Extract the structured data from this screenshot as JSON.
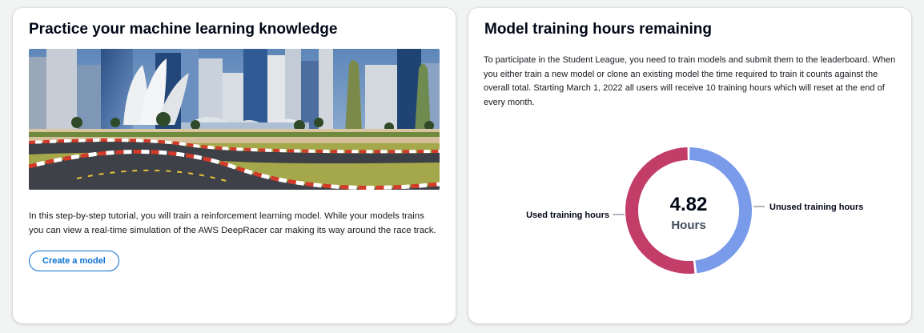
{
  "practice": {
    "title": "Practice your machine learning knowledge",
    "image_alt": "AWS DeepRacer race track in a city",
    "description": "In this step-by-step tutorial, you will train a reinforcement learning model. While your models trains you can view a real-time simulation of the AWS DeepRacer car making its way around the race track.",
    "button_label": "Create a model"
  },
  "training_hours": {
    "title": "Model training hours remaining",
    "description": "To participate in the Student League, you need to train models and submit them to the leaderboard. When you either train a new model or clone an existing model the time required to train it counts against the overall total. Starting March 1, 2022 all users will receive 10 training hours which will reset at the end of every month.",
    "value": "4.82",
    "unit": "Hours",
    "used_label": "Used training hours",
    "unused_label": "Unused training hours",
    "chart_data": {
      "type": "pie",
      "total": 10,
      "slices": [
        {
          "name": "Unused training hours",
          "value": 4.82,
          "color": "#7a9bea"
        },
        {
          "name": "Used training hours",
          "value": 5.18,
          "color": "#c33d69"
        }
      ]
    }
  }
}
